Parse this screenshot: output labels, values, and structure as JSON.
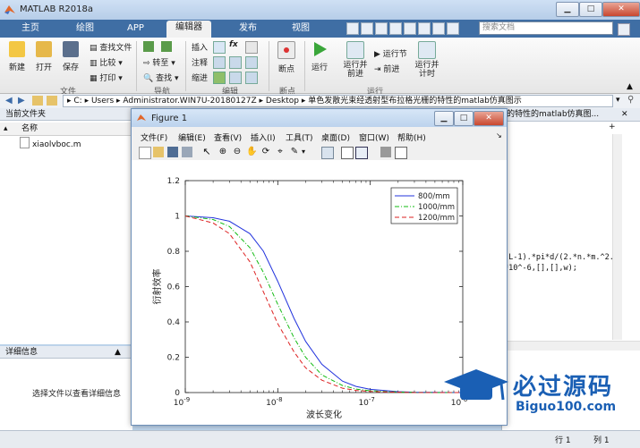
{
  "app": {
    "title": "MATLAB R2018a"
  },
  "ribbon": {
    "tabs": [
      "主页",
      "绘图",
      "APP",
      "编辑器",
      "发布",
      "视图"
    ],
    "active_tab": "编辑器",
    "search_placeholder": "搜索文档",
    "buttons": {
      "new": "新建",
      "open": "打开",
      "save": "保存",
      "find_files": "查找文件",
      "compare": "比较",
      "print": "打印",
      "insert": "插入",
      "comment": "注释",
      "indent": "缩进",
      "goto": "转至",
      "find": "查找",
      "breakpoints": "断点",
      "run": "运行",
      "run_advance": "运行并\n前进",
      "run_section": "运行节",
      "advance": "前进",
      "run_time": "运行并\n计时"
    },
    "groups": {
      "file": "文件",
      "navigate": "导航",
      "edit": "编辑",
      "breakpoints": "断点",
      "run": "运行"
    }
  },
  "address": {
    "segments": [
      "C:",
      "Users",
      "Administrator.WIN7U-20180127Z",
      "Desktop",
      "单色发散光束经透射型布拉格光栅的特性的matlab仿真图示"
    ]
  },
  "left_panel": {
    "header": "当前文件夹",
    "column": "名称",
    "files": [
      {
        "name": "xiaolvboc.m"
      }
    ]
  },
  "detail_panel": {
    "header": "详细信息",
    "hint": "选择文件以查看详细信息"
  },
  "right_panel": {
    "header": "的特性的matlab仿真图...",
    "code_lines": [
      "(L-1).*pi*d/(2.*n.*m.^2.",
      "*10^-6,[],[],w);"
    ]
  },
  "status": {
    "row_label": "行",
    "row": "1",
    "col_label": "列",
    "col": "1"
  },
  "figure": {
    "title": "Figure 1",
    "menus": [
      "文件(F)",
      "编辑(E)",
      "查看(V)",
      "插入(I)",
      "工具(T)",
      "桌面(D)",
      "窗口(W)",
      "帮助(H)"
    ]
  },
  "watermark": {
    "text": "必过源码",
    "url": "Biguo100.com"
  },
  "chart_data": {
    "type": "line",
    "xscale": "log",
    "xlim": [
      1e-09,
      1e-06
    ],
    "ylim": [
      0,
      1.2
    ],
    "xlabel": "波长变化",
    "ylabel": "衍射效率",
    "xticks": [
      "10^-9",
      "10^-8",
      "10^-7",
      "10^-6"
    ],
    "yticks": [
      0,
      0.2,
      0.4,
      0.6,
      0.8,
      1,
      1.2
    ],
    "legend_position": "top-right",
    "series": [
      {
        "name": "800/mm",
        "color": "#2233dd",
        "dash": "solid",
        "x": [
          1e-09,
          2e-09,
          3e-09,
          5e-09,
          7e-09,
          1e-08,
          1.5e-08,
          2e-08,
          3e-08,
          5e-08,
          7e-08,
          1e-07,
          2e-07,
          3e-07,
          5e-07,
          1e-06
        ],
        "y": [
          1.0,
          0.99,
          0.97,
          0.9,
          0.8,
          0.63,
          0.42,
          0.29,
          0.16,
          0.065,
          0.035,
          0.018,
          0.005,
          0.002,
          0.001,
          0.0
        ]
      },
      {
        "name": "1000/mm",
        "color": "#11bb11",
        "dash": "dashdot",
        "x": [
          1e-09,
          2e-09,
          3e-09,
          5e-09,
          7e-09,
          1e-08,
          1.5e-08,
          2e-08,
          3e-08,
          5e-08,
          7e-08,
          1e-07,
          2e-07,
          3e-07,
          5e-07,
          1e-06
        ],
        "y": [
          1.0,
          0.98,
          0.94,
          0.82,
          0.68,
          0.5,
          0.31,
          0.2,
          0.1,
          0.04,
          0.02,
          0.01,
          0.003,
          0.001,
          0.0,
          0.0
        ]
      },
      {
        "name": "1200/mm",
        "color": "#dd2222",
        "dash": "dashed",
        "x": [
          1e-09,
          2e-09,
          3e-09,
          5e-09,
          7e-09,
          1e-08,
          1.5e-08,
          2e-08,
          3e-08,
          5e-08,
          7e-08,
          1e-07,
          2e-07,
          3e-07,
          5e-07,
          1e-06
        ],
        "y": [
          1.0,
          0.96,
          0.9,
          0.74,
          0.57,
          0.39,
          0.23,
          0.14,
          0.07,
          0.025,
          0.012,
          0.006,
          0.002,
          0.0,
          0.0,
          0.0
        ]
      }
    ]
  }
}
